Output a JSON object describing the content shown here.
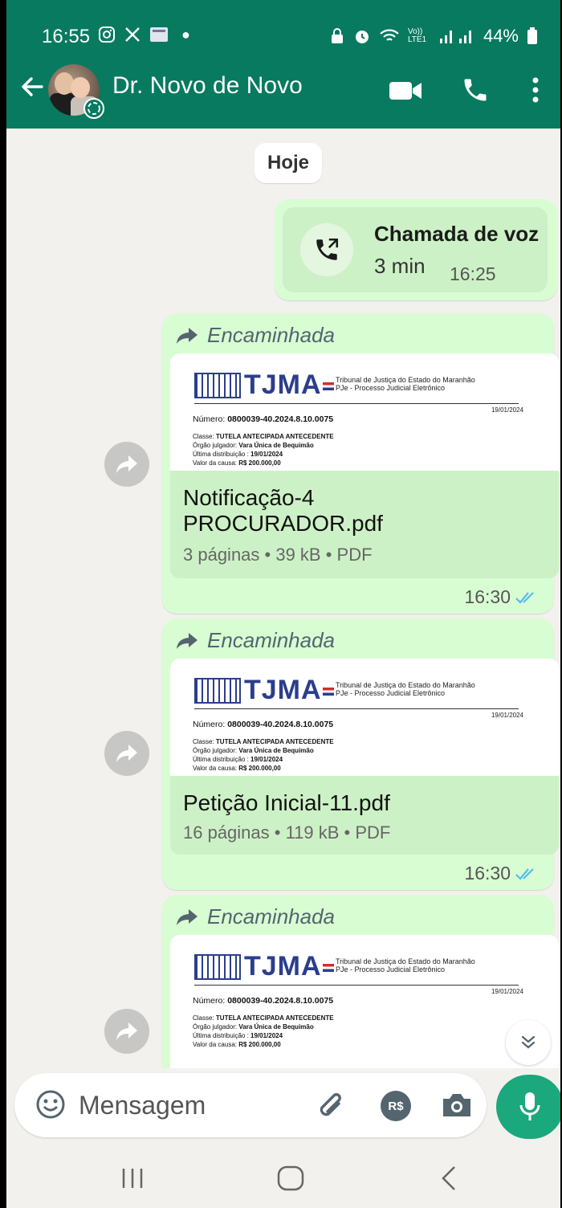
{
  "status_bar": {
    "time": "16:55",
    "battery": "44%",
    "network": "Vo)) LTE1"
  },
  "header": {
    "contact_name": "Dr. Novo de Novo"
  },
  "chat": {
    "date_label": "Hoje",
    "call": {
      "title": "Chamada de voz",
      "duration": "3 min",
      "time": "16:25"
    },
    "forwarded_label": "Encaminhada",
    "doc_preview": {
      "brand": "TJMA",
      "tribunal_line1": "Tribunal de Justiça do Estado do Maranhão",
      "tribunal_line2": "PJe - Processo Judicial Eletrônico",
      "date": "19/01/2024",
      "numero_label": "Número: ",
      "numero_value": "0800039-40.2024.8.10.0075",
      "classe_label": "Classe: ",
      "classe_value": "TUTELA ANTECIPADA ANTECEDENTE",
      "orgao_label": "Órgão julgador: ",
      "orgao_value": "Vara Única de Bequimão",
      "dist_label": "Última distribuição : ",
      "dist_value": "19/01/2024",
      "valor_label": "Valor da causa: ",
      "valor_value": "R$ 200.000,00"
    },
    "messages": [
      {
        "filename_line1": "Notificação-4",
        "filename_line2": "PROCURADOR.pdf",
        "meta": "3 páginas • 39 kB • PDF",
        "time": "16:30"
      },
      {
        "filename_line1": "Petição Inicial-11.pdf",
        "filename_line2": "",
        "meta": "16 páginas • 119 kB • PDF",
        "time": "16:30"
      }
    ]
  },
  "composer": {
    "placeholder": "Mensagem"
  },
  "colors": {
    "header": "#077a60",
    "bubble": "#d9fdd3",
    "accent": "#1aa87c",
    "read_tick": "#53bdeb"
  }
}
